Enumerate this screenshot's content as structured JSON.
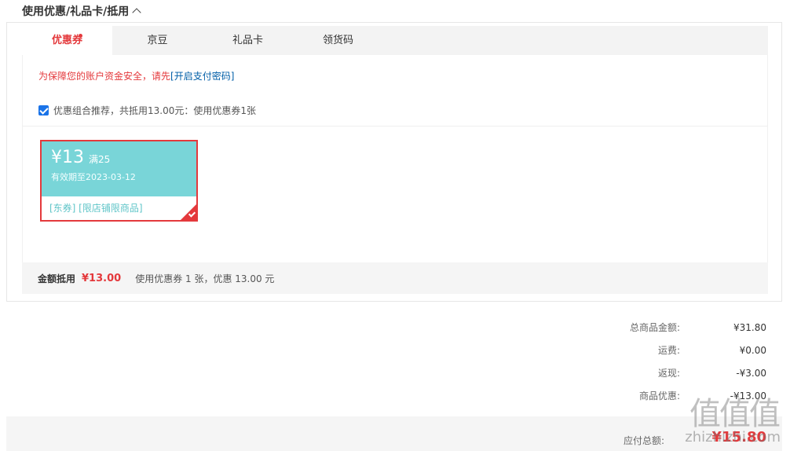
{
  "section": {
    "title": "使用优惠/礼品卡/抵用"
  },
  "tabs": [
    {
      "label": "优惠券",
      "active": true
    },
    {
      "label": "京豆",
      "active": false
    },
    {
      "label": "礼品卡",
      "active": false
    },
    {
      "label": "领货码",
      "active": false
    }
  ],
  "warning": {
    "text": "为保障您的账户资金安全，请先",
    "link": "[开启支付密码]"
  },
  "combo": {
    "checked": true,
    "text": "优惠组合推荐，共抵用13.00元：使用优惠券1张"
  },
  "coupon": {
    "amount": "¥13",
    "condition": "满25",
    "valid": "有效期至2023-03-12",
    "tags": "[东券] [限店铺限商品]"
  },
  "deduct": {
    "label": "金额抵用",
    "amount": "¥13.00",
    "desc": "使用优惠券 1 张，优惠 13.00 元"
  },
  "summary": [
    {
      "key": "总商品金额:",
      "value": "¥31.80"
    },
    {
      "key": "运费:",
      "value": "¥0.00"
    },
    {
      "key": "返现:",
      "value": "-¥3.00"
    },
    {
      "key": "商品优惠:",
      "value": "-¥13.00"
    }
  ],
  "total": {
    "key": "应付总额:",
    "value": "¥15.80"
  },
  "watermark": {
    "glyphs": "值值值",
    "site": "zhizhizhi.com"
  },
  "colors": {
    "accent": "#e4393c",
    "coupon_bg": "#79d5d8",
    "link": "#005ea7"
  }
}
